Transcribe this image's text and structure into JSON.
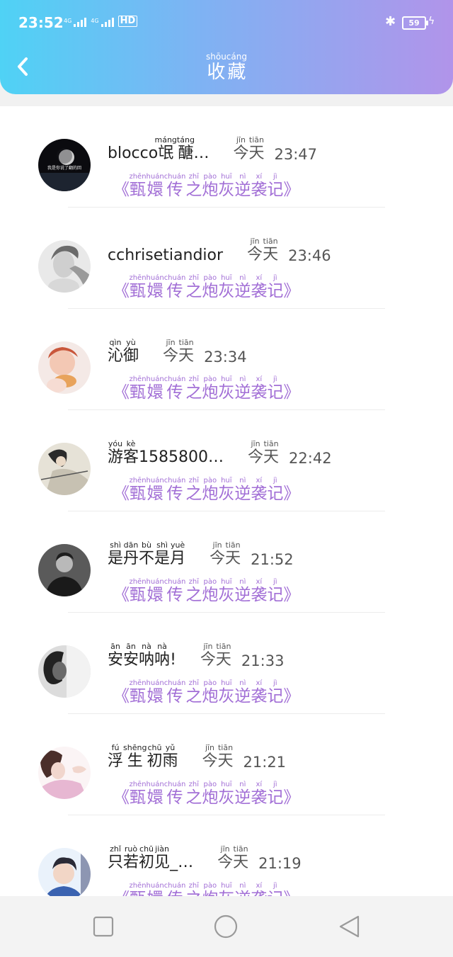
{
  "status": {
    "time": "23:52",
    "net1": "4G",
    "net2": "4G",
    "hd": "HD",
    "battery": "59"
  },
  "header": {
    "title": [
      {
        "ch": "收",
        "py": "shōu"
      },
      {
        "ch": "藏",
        "py": "cáng"
      }
    ]
  },
  "items": [
    {
      "name": [
        {
          "ch": "blocco"
        },
        {
          "ch": "氓",
          "py": "máng"
        },
        {
          "ch": "醣",
          "py": "táng"
        },
        {
          "ch": "…"
        }
      ],
      "day": [
        {
          "ch": "今",
          "py": "jīn"
        },
        {
          "ch": "天",
          "py": "tiān"
        }
      ],
      "time": "23:47",
      "sub": [
        {
          "ch": "《"
        },
        {
          "ch": "甄",
          "py": "zhēn"
        },
        {
          "ch": "嬛",
          "py": "huán"
        },
        {
          "ch": "传",
          "py": "chuán"
        },
        {
          "ch": "之",
          "py": "zhī"
        },
        {
          "ch": "炮",
          "py": "pào"
        },
        {
          "ch": "灰",
          "py": "huī"
        },
        {
          "ch": "逆",
          "py": "nì"
        },
        {
          "ch": "袭",
          "py": "xí"
        },
        {
          "ch": "记",
          "py": "jì"
        },
        {
          "ch": "》"
        }
      ],
      "avatar_caption": "我是你说了翻的回"
    },
    {
      "name": [
        {
          "ch": "cchrisetiandior"
        }
      ],
      "day": [
        {
          "ch": "今",
          "py": "jīn"
        },
        {
          "ch": "天",
          "py": "tiān"
        }
      ],
      "time": "23:46",
      "sub": [
        {
          "ch": "《"
        },
        {
          "ch": "甄",
          "py": "zhēn"
        },
        {
          "ch": "嬛",
          "py": "huán"
        },
        {
          "ch": "传",
          "py": "chuán"
        },
        {
          "ch": "之",
          "py": "zhī"
        },
        {
          "ch": "炮",
          "py": "pào"
        },
        {
          "ch": "灰",
          "py": "huī"
        },
        {
          "ch": "逆",
          "py": "nì"
        },
        {
          "ch": "袭",
          "py": "xí"
        },
        {
          "ch": "记",
          "py": "jì"
        },
        {
          "ch": "》"
        }
      ]
    },
    {
      "name": [
        {
          "ch": "沁",
          "py": "qìn"
        },
        {
          "ch": "御",
          "py": "yù"
        }
      ],
      "day": [
        {
          "ch": "今",
          "py": "jīn"
        },
        {
          "ch": "天",
          "py": "tiān"
        }
      ],
      "time": "23:34",
      "sub": [
        {
          "ch": "《"
        },
        {
          "ch": "甄",
          "py": "zhēn"
        },
        {
          "ch": "嬛",
          "py": "huán"
        },
        {
          "ch": "传",
          "py": "chuán"
        },
        {
          "ch": "之",
          "py": "zhī"
        },
        {
          "ch": "炮",
          "py": "pào"
        },
        {
          "ch": "灰",
          "py": "huī"
        },
        {
          "ch": "逆",
          "py": "nì"
        },
        {
          "ch": "袭",
          "py": "xí"
        },
        {
          "ch": "记",
          "py": "jì"
        },
        {
          "ch": "》"
        }
      ]
    },
    {
      "name": [
        {
          "ch": "游",
          "py": "yóu"
        },
        {
          "ch": "客",
          "py": "kè"
        },
        {
          "ch": "1585800…"
        }
      ],
      "day": [
        {
          "ch": "今",
          "py": "jīn"
        },
        {
          "ch": "天",
          "py": "tiān"
        }
      ],
      "time": "22:42",
      "sub": [
        {
          "ch": "《"
        },
        {
          "ch": "甄",
          "py": "zhēn"
        },
        {
          "ch": "嬛",
          "py": "huán"
        },
        {
          "ch": "传",
          "py": "chuán"
        },
        {
          "ch": "之",
          "py": "zhī"
        },
        {
          "ch": "炮",
          "py": "pào"
        },
        {
          "ch": "灰",
          "py": "huī"
        },
        {
          "ch": "逆",
          "py": "nì"
        },
        {
          "ch": "袭",
          "py": "xí"
        },
        {
          "ch": "记",
          "py": "jì"
        },
        {
          "ch": "》"
        }
      ]
    },
    {
      "name": [
        {
          "ch": "是",
          "py": "shì"
        },
        {
          "ch": "丹",
          "py": "dān"
        },
        {
          "ch": "不",
          "py": "bù"
        },
        {
          "ch": "是",
          "py": "shì"
        },
        {
          "ch": "月",
          "py": "yuè"
        }
      ],
      "day": [
        {
          "ch": "今",
          "py": "jīn"
        },
        {
          "ch": "天",
          "py": "tiān"
        }
      ],
      "time": "21:52",
      "sub": [
        {
          "ch": "《"
        },
        {
          "ch": "甄",
          "py": "zhēn"
        },
        {
          "ch": "嬛",
          "py": "huán"
        },
        {
          "ch": "传",
          "py": "chuán"
        },
        {
          "ch": "之",
          "py": "zhī"
        },
        {
          "ch": "炮",
          "py": "pào"
        },
        {
          "ch": "灰",
          "py": "huī"
        },
        {
          "ch": "逆",
          "py": "nì"
        },
        {
          "ch": "袭",
          "py": "xí"
        },
        {
          "ch": "记",
          "py": "jì"
        },
        {
          "ch": "》"
        }
      ]
    },
    {
      "name": [
        {
          "ch": "安",
          "py": "ān"
        },
        {
          "ch": "安",
          "py": "ān"
        },
        {
          "ch": "呐",
          "py": "nà"
        },
        {
          "ch": "呐",
          "py": "nà"
        },
        {
          "ch": "!"
        }
      ],
      "day": [
        {
          "ch": "今",
          "py": "jīn"
        },
        {
          "ch": "天",
          "py": "tiān"
        }
      ],
      "time": "21:33",
      "sub": [
        {
          "ch": "《"
        },
        {
          "ch": "甄",
          "py": "zhēn"
        },
        {
          "ch": "嬛",
          "py": "huán"
        },
        {
          "ch": "传",
          "py": "chuán"
        },
        {
          "ch": "之",
          "py": "zhī"
        },
        {
          "ch": "炮",
          "py": "pào"
        },
        {
          "ch": "灰",
          "py": "huī"
        },
        {
          "ch": "逆",
          "py": "nì"
        },
        {
          "ch": "袭",
          "py": "xí"
        },
        {
          "ch": "记",
          "py": "jì"
        },
        {
          "ch": "》"
        }
      ]
    },
    {
      "name": [
        {
          "ch": "浮",
          "py": "fú"
        },
        {
          "ch": "生",
          "py": "shēng"
        },
        {
          "ch": "初",
          "py": "chū"
        },
        {
          "ch": "雨",
          "py": "yǔ"
        }
      ],
      "day": [
        {
          "ch": "今",
          "py": "jīn"
        },
        {
          "ch": "天",
          "py": "tiān"
        }
      ],
      "time": "21:21",
      "sub": [
        {
          "ch": "《"
        },
        {
          "ch": "甄",
          "py": "zhēn"
        },
        {
          "ch": "嬛",
          "py": "huán"
        },
        {
          "ch": "传",
          "py": "chuán"
        },
        {
          "ch": "之",
          "py": "zhī"
        },
        {
          "ch": "炮",
          "py": "pào"
        },
        {
          "ch": "灰",
          "py": "huī"
        },
        {
          "ch": "逆",
          "py": "nì"
        },
        {
          "ch": "袭",
          "py": "xí"
        },
        {
          "ch": "记",
          "py": "jì"
        },
        {
          "ch": "》"
        }
      ]
    },
    {
      "name": [
        {
          "ch": "只",
          "py": "zhǐ"
        },
        {
          "ch": "若",
          "py": "ruò"
        },
        {
          "ch": "初",
          "py": "chū"
        },
        {
          "ch": "见",
          "py": "jiàn"
        },
        {
          "ch": "_…"
        }
      ],
      "day": [
        {
          "ch": "今",
          "py": "jīn"
        },
        {
          "ch": "天",
          "py": "tiān"
        }
      ],
      "time": "21:19",
      "sub": [
        {
          "ch": "《"
        },
        {
          "ch": "甄",
          "py": "zhēn"
        },
        {
          "ch": "嬛",
          "py": "huán"
        },
        {
          "ch": "传",
          "py": "chuán"
        },
        {
          "ch": "之",
          "py": "zhī"
        },
        {
          "ch": "炮",
          "py": "pào"
        },
        {
          "ch": "灰",
          "py": "huī"
        },
        {
          "ch": "逆",
          "py": "nì"
        },
        {
          "ch": "袭",
          "py": "xí"
        },
        {
          "ch": "记",
          "py": "jì"
        },
        {
          "ch": "》"
        }
      ]
    }
  ],
  "colors": {
    "accent_purple": "#a26fd6",
    "header_start": "#4fd2f5",
    "header_end": "#b194ea"
  },
  "icons": {
    "back": "chevron-left-icon",
    "bluetooth": "bluetooth-icon",
    "nav_recent": "square-icon",
    "nav_home": "circle-icon",
    "nav_back": "triangle-back-icon"
  }
}
